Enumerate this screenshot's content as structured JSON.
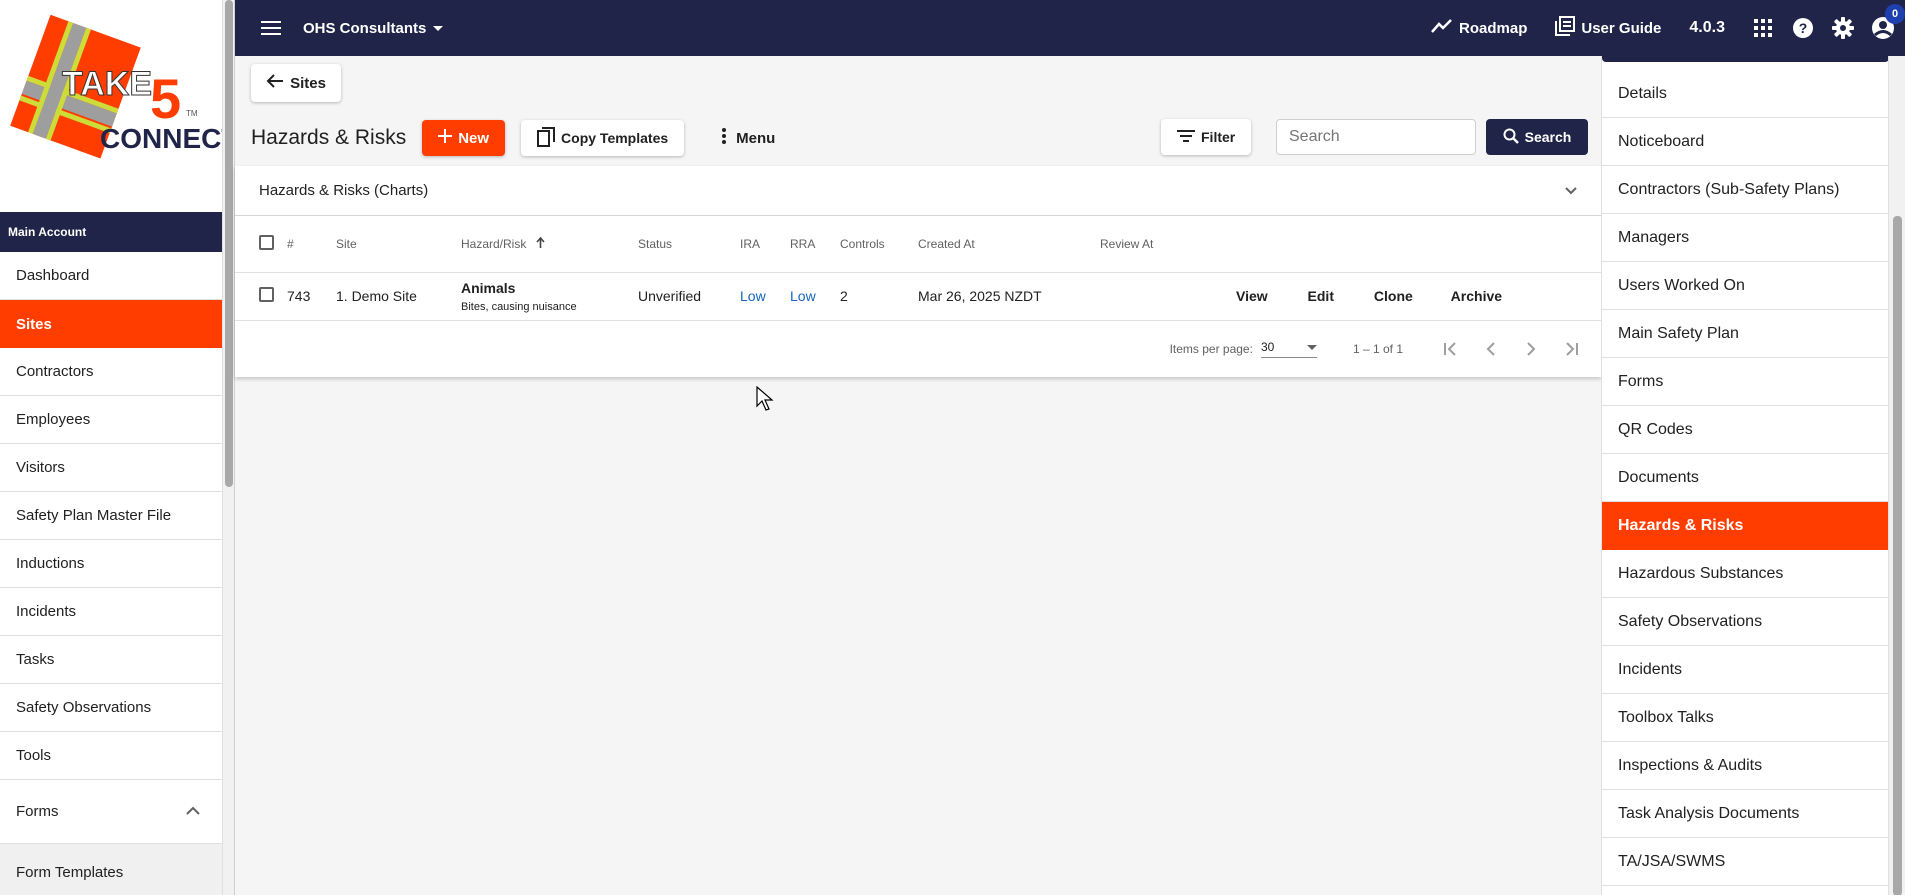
{
  "brand": {
    "logo_text_top": "TAKE",
    "logo_text_num": "5",
    "logo_text_bottom": "CONNECT",
    "logo_tm": "TM",
    "accent": "#ff3d00",
    "navy": "#1f2448"
  },
  "topbar": {
    "org": "OHS Consultants",
    "roadmap": "Roadmap",
    "user_guide": "User Guide",
    "version": "4.0.3",
    "notifications": "0"
  },
  "sidebar": {
    "account_header": "Main Account",
    "items": [
      {
        "label": "Dashboard"
      },
      {
        "label": "Sites"
      },
      {
        "label": "Contractors"
      },
      {
        "label": "Employees"
      },
      {
        "label": "Visitors"
      },
      {
        "label": "Safety Plan Master File"
      },
      {
        "label": "Inductions"
      },
      {
        "label": "Incidents"
      },
      {
        "label": "Tasks"
      },
      {
        "label": "Safety Observations"
      },
      {
        "label": "Tools"
      }
    ],
    "forms": "Forms",
    "form_templates": "Form Templates"
  },
  "main": {
    "back_label": "Sites",
    "title": "Hazards & Risks",
    "new_label": "New",
    "copy_label": "Copy Templates",
    "menu_label": "Menu",
    "filter_label": "Filter",
    "search_placeholder": "Search",
    "search_label": "Search",
    "charts_label": "Hazards & Risks (Charts)",
    "columns": [
      "#",
      "Site",
      "Hazard/Risk",
      "Status",
      "IRA",
      "RRA",
      "Controls",
      "Created At",
      "Review At"
    ],
    "rows": [
      {
        "id": "743",
        "site": "1. Demo Site",
        "hazard": "Animals",
        "hazard_sub": "Bites, causing nuisance",
        "status": "Unverified",
        "ira": "Low",
        "rra": "Low",
        "controls": "2",
        "created": "Mar 26, 2025 NZDT",
        "review": "",
        "actions": [
          "View",
          "Edit",
          "Clone",
          "Archive"
        ]
      }
    ],
    "paginator": {
      "items_label": "Items per page:",
      "per_page": "30",
      "range": "1 – 1 of 1"
    }
  },
  "right_nav": {
    "items": [
      {
        "label": "Details"
      },
      {
        "label": "Noticeboard"
      },
      {
        "label": "Contractors (Sub-Safety Plans)"
      },
      {
        "label": "Managers"
      },
      {
        "label": "Users Worked On"
      },
      {
        "label": "Main Safety Plan"
      },
      {
        "label": "Forms"
      },
      {
        "label": "QR Codes"
      },
      {
        "label": "Documents"
      },
      {
        "label": "Hazards & Risks"
      },
      {
        "label": "Hazardous Substances"
      },
      {
        "label": "Safety Observations"
      },
      {
        "label": "Incidents"
      },
      {
        "label": "Toolbox Talks"
      },
      {
        "label": "Inspections & Audits"
      },
      {
        "label": "Task Analysis Documents"
      },
      {
        "label": "TA/JSA/SWMS"
      }
    ]
  }
}
